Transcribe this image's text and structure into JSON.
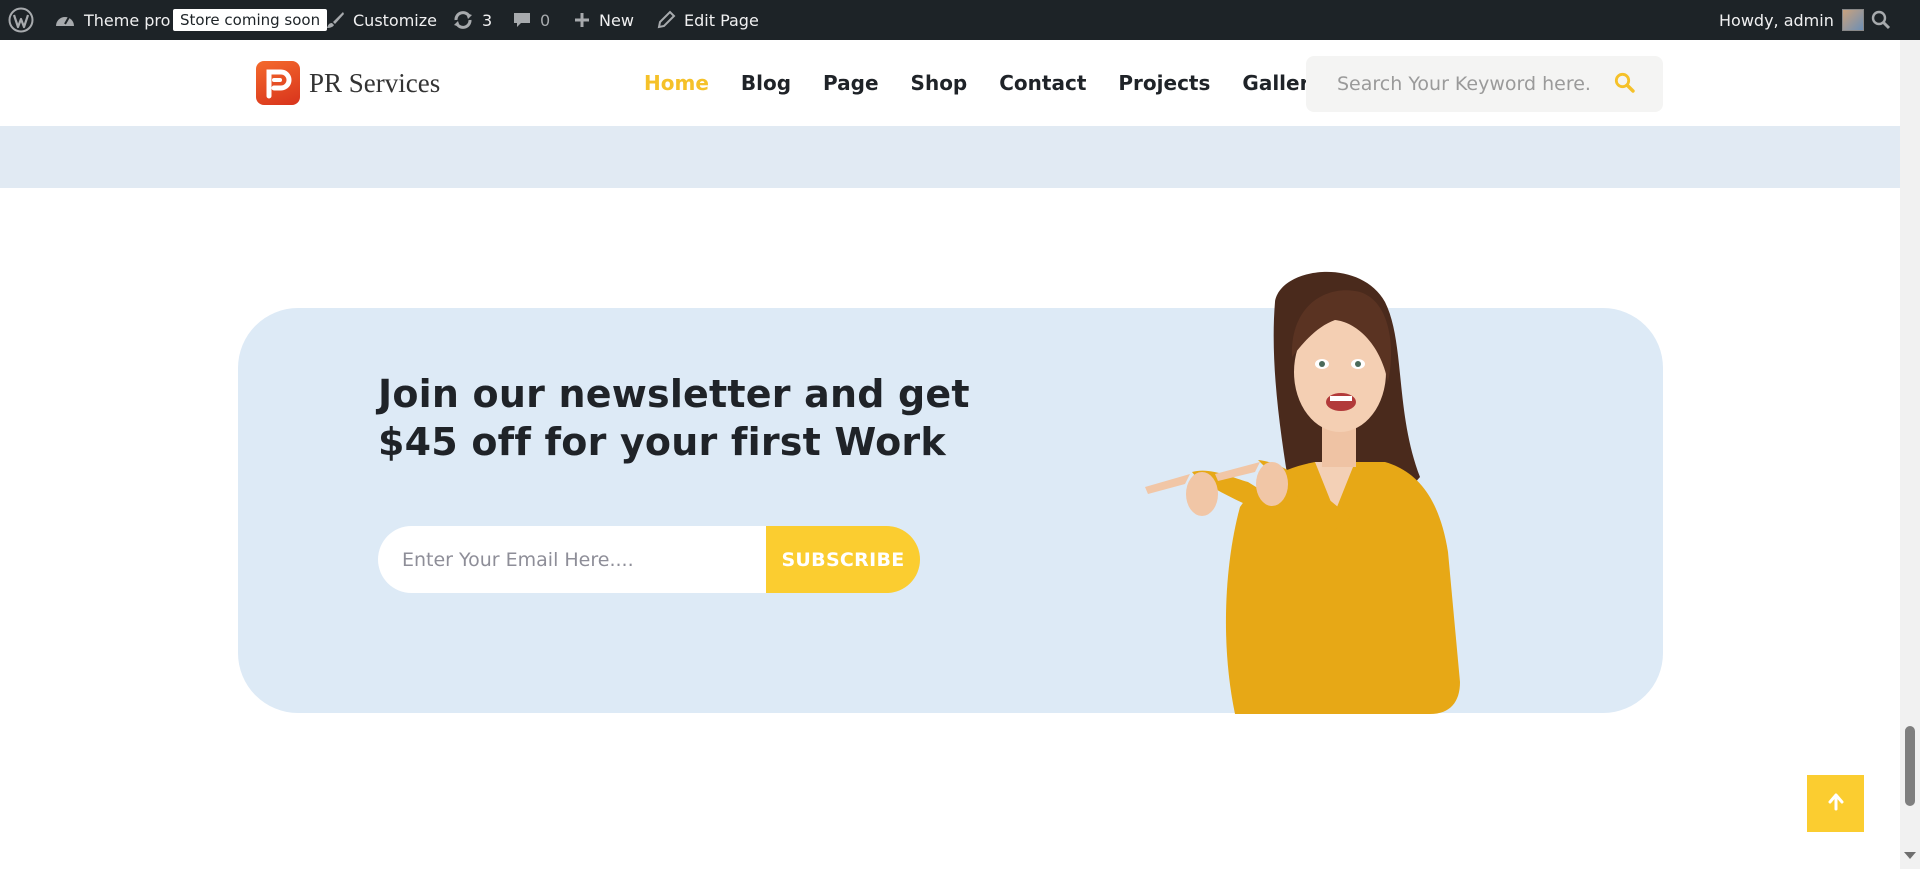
{
  "admin_bar": {
    "site_name": "Theme pro",
    "store_badge": "Store coming soon",
    "customize": "Customize",
    "updates_count": "3",
    "comments_count": "0",
    "new_label": "New",
    "edit_page": "Edit Page",
    "howdy": "Howdy, admin"
  },
  "header": {
    "logo_text": "PR Services",
    "nav": [
      "Home",
      "Blog",
      "Page",
      "Shop",
      "Contact",
      "Projects",
      "Gallery"
    ],
    "active_nav": "Home",
    "search_placeholder": "Search Your Keyword here."
  },
  "newsletter": {
    "heading_line1": "Join our newsletter and get",
    "heading_line2": "$45 off for your first Work",
    "email_placeholder": "Enter Your Email Here....",
    "button_label": "SUBSCRIBE"
  },
  "colors": {
    "accent": "#fbcd30",
    "nav_active": "#f5c129",
    "admin_bar": "#1d2327",
    "newsletter_bg": "#ddeaf6"
  },
  "icons": {
    "wordpress": "wordpress-icon",
    "dashboard": "dashboard-icon",
    "customize": "brush-icon",
    "updates": "refresh-icon",
    "comments": "comment-icon",
    "new": "plus-icon",
    "edit": "pencil-icon",
    "search": "search-icon",
    "to_top": "arrow-up-icon"
  }
}
